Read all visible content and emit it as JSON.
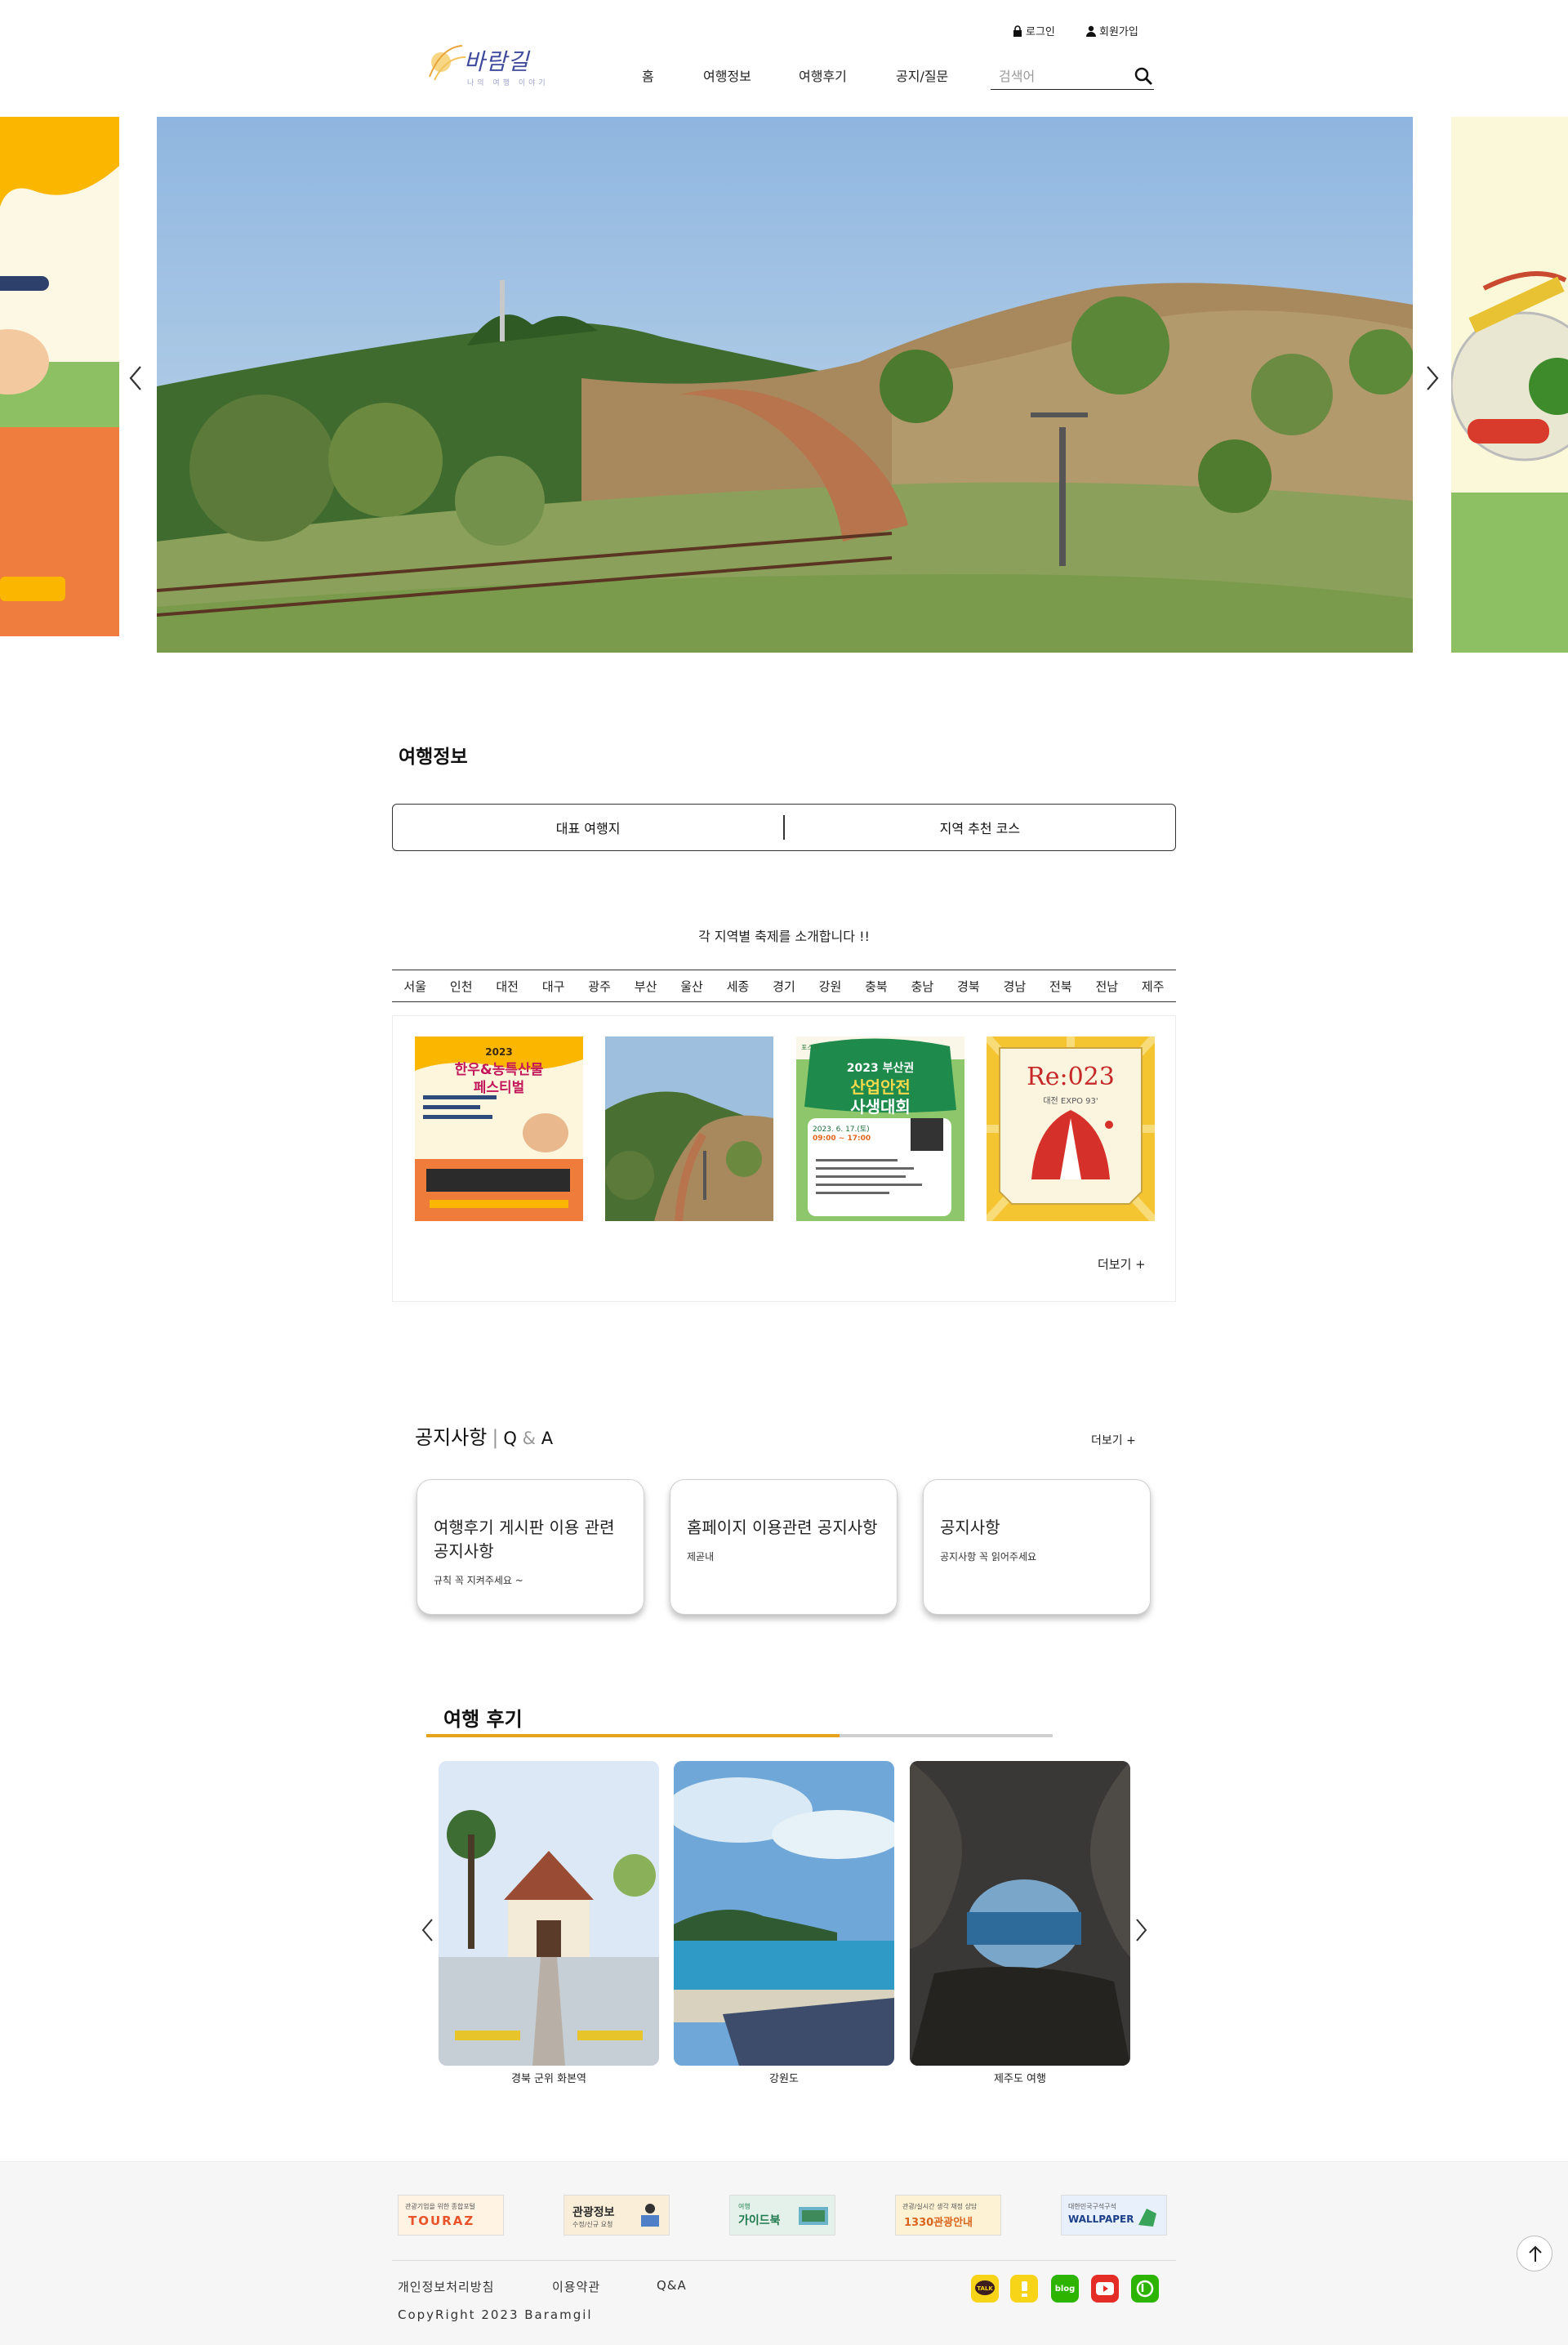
{
  "header": {
    "logo_text": "바람길",
    "logo_sub": "나의 여행 이야기",
    "util": {
      "login": "로그인",
      "join": "회원가입"
    },
    "nav": [
      "홈",
      "여행정보",
      "여행후기",
      "공지/질문"
    ],
    "search": {
      "placeholder": "검색어",
      "value": ""
    }
  },
  "travel_info": {
    "title": "여행정보",
    "tabs": [
      "대표 여행지",
      "지역 추천 코스"
    ],
    "festival_heading": "각 지역별 축제를 소개합니다 !!",
    "regions": [
      "서울",
      "인천",
      "대전",
      "대구",
      "광주",
      "부산",
      "울산",
      "세종",
      "경기",
      "강원",
      "충북",
      "충남",
      "경북",
      "경남",
      "전북",
      "전남",
      "제주"
    ],
    "posters": [
      {
        "year": "2023",
        "title_line1": "한우&농특산물",
        "title_line2": "페스티벌"
      },
      {
        "title_line1": ""
      },
      {
        "tag": "포스터",
        "title_line1": "2023 부산권",
        "title_line2": "산업안전",
        "title_line3": "사생대회",
        "date": "2023. 6. 17.(토)",
        "time": "09:00 ~ 17:00"
      },
      {
        "title_line1": "Re:023",
        "title_line2": "대전 EXPO 93'"
      }
    ],
    "more": "더보기 +"
  },
  "notice": {
    "title": "공지사항",
    "qa_q": "Q",
    "qa_amp": "&",
    "qa_a": "A",
    "more": "더보기 +",
    "cards": [
      {
        "title": "여행후기 게시판 이용 관련 공지사항",
        "sub": "규칙 꼭 지켜주세요 ~"
      },
      {
        "title": "홈페이지 이용관련 공지사항",
        "sub": "제곧내"
      },
      {
        "title": "공지사항",
        "sub": "공지사항 꼭 읽어주세요"
      }
    ]
  },
  "reviews": {
    "title": "여행 후기",
    "progress": 0.66,
    "items": [
      {
        "caption": "경북 군위 화본역"
      },
      {
        "caption": "강원도"
      },
      {
        "caption": "제주도 여행"
      }
    ]
  },
  "footer": {
    "banners": [
      {
        "small": "관광기업을 위한 종합포털",
        "main": "TOURAZ"
      },
      {
        "small": "수정/신규 요청",
        "main": "관광정보"
      },
      {
        "small": "여행",
        "main": "가이드북"
      },
      {
        "small": "관광/실시간 생각 재정 상담",
        "main": "1330관광안내"
      },
      {
        "small": "대한민국구석구석",
        "main": "WALLPAPER"
      }
    ],
    "links": [
      "개인정보처리방침",
      "이용약관",
      "Q&A"
    ],
    "copyright": "CopyRight 2023 Baramgil",
    "sns": [
      {
        "label": "TALK",
        "color": "#f7d417",
        "text_color": "#3c1e1e"
      },
      {
        "label": "",
        "color": "#f7d417",
        "text_color": "#3c1e1e"
      },
      {
        "label": "blog",
        "color": "#2db400",
        "text_color": "#ffffff"
      },
      {
        "label": "",
        "color": "#e52d27",
        "text_color": "#ffffff"
      },
      {
        "label": "",
        "color": "#2db400",
        "text_color": "#ffffff"
      }
    ]
  },
  "colors": {
    "accent": "#e6a21b",
    "text": "#111111"
  }
}
